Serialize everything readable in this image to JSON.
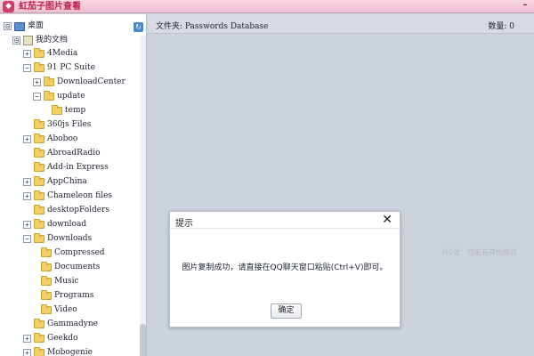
{
  "window": {
    "title": "虹茄子图片查看",
    "icon_name": "app-logo-icon",
    "minimize_glyph": "–"
  },
  "tree": {
    "root": {
      "label": "桌面",
      "expander": "⊟"
    },
    "my_docs": {
      "label": "我的文档",
      "expander": "⊟"
    },
    "items": [
      {
        "label": "4Media",
        "expander": "+"
      },
      {
        "label": "91 PC Suite",
        "expander": "−"
      },
      {
        "label": "DownloadCenter",
        "expander": "+"
      },
      {
        "label": "update",
        "expander": "−"
      },
      {
        "label": "temp",
        "expander": ""
      },
      {
        "label": "360js Files",
        "expander": ""
      },
      {
        "label": "Aboboo",
        "expander": "+"
      },
      {
        "label": "AbroadRadio",
        "expander": ""
      },
      {
        "label": "Add-in Express",
        "expander": ""
      },
      {
        "label": "AppChina",
        "expander": "+"
      },
      {
        "label": "Chameleon files",
        "expander": "+"
      },
      {
        "label": "desktopFolders",
        "expander": ""
      },
      {
        "label": "download",
        "expander": "+"
      },
      {
        "label": "Downloads",
        "expander": "−"
      },
      {
        "label": "Compressed",
        "expander": ""
      },
      {
        "label": "Documents",
        "expander": ""
      },
      {
        "label": "Music",
        "expander": ""
      },
      {
        "label": "Programs",
        "expander": ""
      },
      {
        "label": "Video",
        "expander": ""
      },
      {
        "label": "Gammadyne",
        "expander": ""
      },
      {
        "label": "Geekdo",
        "expander": "+"
      },
      {
        "label": "Mobogenie",
        "expander": "+"
      }
    ]
  },
  "main": {
    "folder_label": "文件夹: Passwords Database",
    "count_label": "数量: 0",
    "ghost_text": "共0张：可能有其他格式"
  },
  "dialog": {
    "title": "提示",
    "close_glyph": "✕",
    "message": "图片复制成功，请直接在QQ聊天窗口粘贴(Ctrl+V)即可。",
    "ok_label": "确定"
  },
  "colors": {
    "titlebar": "#eebfd0",
    "title_text": "#c0224f",
    "main_bg": "#cdd3dc",
    "folder_icon": "#f3cf62"
  }
}
